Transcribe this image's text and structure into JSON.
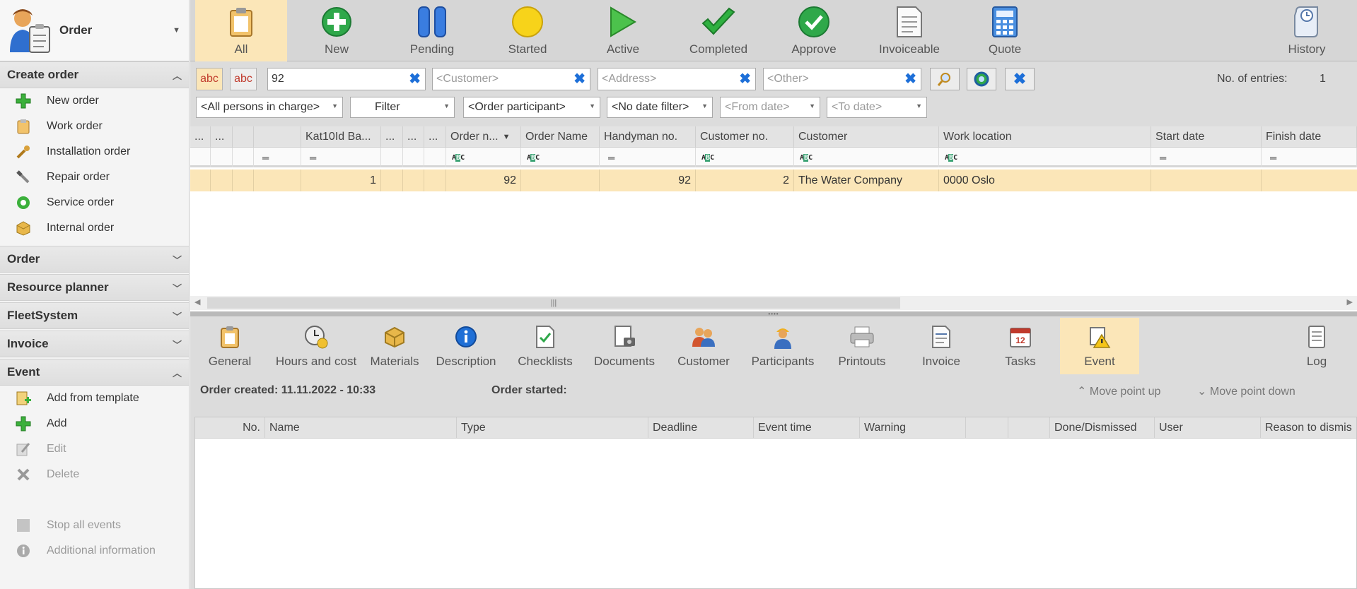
{
  "sidebar": {
    "title": "Order",
    "sections": {
      "create_order": {
        "label": "Create order",
        "items": [
          "New order",
          "Work order",
          "Installation order",
          "Repair order",
          "Service order",
          "Internal order"
        ]
      },
      "order": {
        "label": "Order"
      },
      "resource_planner": {
        "label": "Resource planner"
      },
      "fleet_system": {
        "label": "FleetSystem"
      },
      "invoice": {
        "label": "Invoice"
      },
      "event": {
        "label": "Event",
        "items": [
          "Add from template",
          "Add",
          "Edit",
          "Delete"
        ],
        "extra": [
          "Stop all events",
          "Additional information"
        ]
      }
    }
  },
  "toolbar": {
    "buttons": [
      "All",
      "New",
      "Pending",
      "Started",
      "Active",
      "Completed",
      "Approve",
      "Invoiceable",
      "Quote",
      "History"
    ],
    "selected": "All"
  },
  "filters": {
    "chip1": "abc",
    "chip2": "abc",
    "search_value": "92",
    "customer_placeholder": "<Customer>",
    "address_placeholder": "<Address>",
    "other_placeholder": "<Other>",
    "entries_label": "No. of entries:",
    "entries_count": "1",
    "persons": "<All persons in charge>",
    "filter": "Filter",
    "participant": "<Order participant>",
    "date_filter": "<No date filter>",
    "from_date": "<From date>",
    "to_date": "<To date>"
  },
  "grid": {
    "columns": [
      "...",
      "...",
      "",
      "Kat10Id Ba...",
      "...",
      "...",
      "...",
      "Order n...",
      "Order Name",
      "Handyman no.",
      "Customer no.",
      "Customer",
      "Work location",
      "Start date",
      "Finish date"
    ],
    "sort_indicator": "▼",
    "rows": [
      {
        "kat10id": "1",
        "order_no": "92",
        "order_name": "",
        "handyman_no": "92",
        "customer_no": "2",
        "customer": "The Water Company",
        "work_location": "0000 Oslo",
        "start_date": "",
        "finish_date": ""
      }
    ]
  },
  "detail": {
    "tabs": [
      "General",
      "Hours and cost",
      "Materials",
      "Description",
      "Checklists",
      "Documents",
      "Customer",
      "Participants",
      "Printouts",
      "Invoice",
      "Tasks",
      "Event",
      "Log"
    ],
    "selected_tab": "Event",
    "order_created": "Order created: 11.11.2022 - 10:33",
    "order_started": "Order started:",
    "move_up": "Move point up",
    "move_down": "Move point down",
    "event_columns": [
      "No.",
      "Name",
      "Type",
      "Deadline",
      "Event time",
      "Warning",
      "",
      "",
      "Done/Dismissed",
      "User",
      "Reason to dismis"
    ]
  },
  "colors": {
    "selected": "#fbe6b8",
    "toolbar_bg": "#d6d6d6",
    "accent_blue": "#1d6fd8"
  }
}
